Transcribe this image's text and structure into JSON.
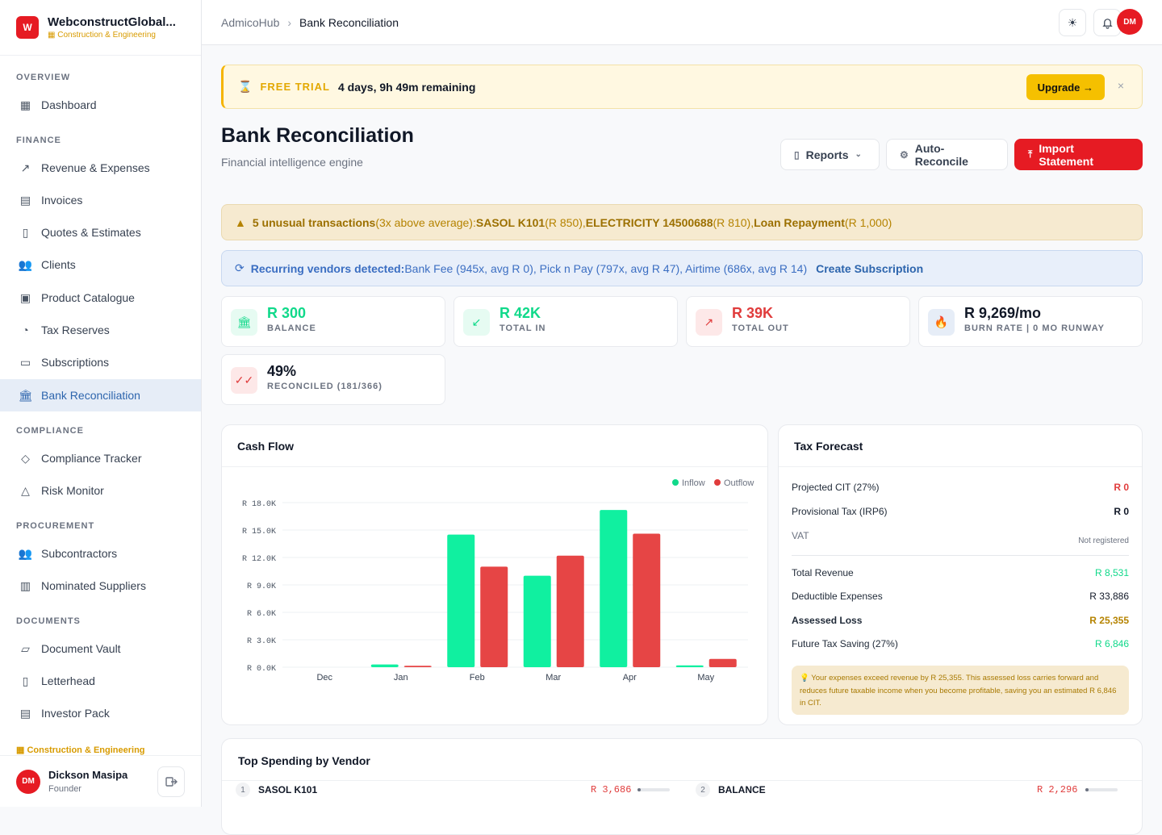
{
  "brand": {
    "logo": "W",
    "name": "WebconstructGlobal...",
    "industry": "Construction & Engineering"
  },
  "sidebar": {
    "sections": [
      {
        "title": "OVERVIEW",
        "items": [
          {
            "label": "Dashboard",
            "icon": "dashboard-icon"
          }
        ]
      },
      {
        "title": "FINANCE",
        "items": [
          {
            "label": "Revenue & Expenses",
            "icon": "chart-line-icon"
          },
          {
            "label": "Invoices",
            "icon": "invoice-icon"
          },
          {
            "label": "Quotes & Estimates",
            "icon": "quote-icon"
          },
          {
            "label": "Clients",
            "icon": "users-icon"
          },
          {
            "label": "Product Catalogue",
            "icon": "package-icon"
          },
          {
            "label": "Tax Reserves",
            "icon": "piggy-bank-icon"
          },
          {
            "label": "Subscriptions",
            "icon": "card-icon"
          },
          {
            "label": "Bank Reconciliation",
            "icon": "bank-icon",
            "active": true
          }
        ]
      },
      {
        "title": "COMPLIANCE",
        "items": [
          {
            "label": "Compliance Tracker",
            "icon": "shield-icon"
          },
          {
            "label": "Risk Monitor",
            "icon": "warning-icon"
          }
        ]
      },
      {
        "title": "PROCUREMENT",
        "items": [
          {
            "label": "Subcontractors",
            "icon": "people-icon"
          },
          {
            "label": "Nominated Suppliers",
            "icon": "store-icon"
          }
        ]
      },
      {
        "title": "DOCUMENTS",
        "items": [
          {
            "label": "Document Vault",
            "icon": "folder-icon"
          },
          {
            "label": "Letterhead",
            "icon": "file-icon"
          },
          {
            "label": "Investor Pack",
            "icon": "briefcase-icon"
          }
        ]
      }
    ],
    "industry_label": "Construction & Engineering",
    "user": {
      "initials": "DM",
      "name": "Dickson Masipa",
      "role": "Founder"
    }
  },
  "topbar": {
    "crumb_root": "AdmicoHub",
    "crumb_current": "Bank Reconciliation",
    "avatar": "DM"
  },
  "trial": {
    "label": "FREE TRIAL",
    "time": "4 days, 9h 49m remaining",
    "upgrade": "Upgrade →",
    "close": "×"
  },
  "header": {
    "title": "Bank Reconciliation",
    "subtitle": "Financial intelligence engine",
    "reports": "Reports",
    "auto": "Auto-Reconcile",
    "import": "Import Statement"
  },
  "alerts": {
    "unusual_count": "5 unusual transactions",
    "unusual_mid": " (3x above average): ",
    "u1": "SASOL K101",
    "u1v": " (R 850), ",
    "u2": "ELECTRICITY 14500688",
    "u2v": " (R 810), ",
    "u3": "Loan Repayment",
    "u3v": " (R 1,000)",
    "recurring_label": "Recurring vendors detected:",
    "recurring_text": " Bank Fee (945x, avg R 0), Pick n Pay (797x, avg R 47), Airtime (686x, avg R 14)",
    "recurring_link": "Create Subscription"
  },
  "stats": [
    {
      "value": "R 300",
      "label": "BALANCE",
      "color": "#10d98a",
      "bg": "#e6fbf2",
      "glyph": "🏛",
      "glyph_name": "bank-icon"
    },
    {
      "value": "R 42K",
      "label": "TOTAL IN",
      "color": "#10d98a",
      "bg": "#e6fbf2",
      "glyph": "↙",
      "glyph_name": "arrow-down-left-icon"
    },
    {
      "value": "R 39K",
      "label": "TOTAL OUT",
      "color": "#e03c3c",
      "bg": "#fde8e8",
      "glyph": "↗",
      "glyph_name": "arrow-up-right-icon"
    },
    {
      "value": "R 9,269/mo",
      "label": "BURN RATE | 0 MO RUNWAY",
      "color": "#111827",
      "bg": "#e6edf7",
      "glyph": "🔥",
      "glyph_name": "flame-icon"
    },
    {
      "value": "49%",
      "label": "RECONCILED (181/366)",
      "color": "#111827",
      "bg": "#fde8e8",
      "glyph": "✓✓",
      "glyph_name": "check-double-icon"
    }
  ],
  "cashflow": {
    "title": "Cash Flow",
    "legend_in": "Inflow",
    "legend_out": "Outflow"
  },
  "chart_data": {
    "type": "bar",
    "title": "Cash Flow",
    "categories": [
      "Dec",
      "Jan",
      "Feb",
      "Mar",
      "Apr",
      "May"
    ],
    "series": [
      {
        "name": "Inflow",
        "color": "#10f0a0",
        "values": [
          0,
          300,
          14500,
          10000,
          17200,
          200
        ]
      },
      {
        "name": "Outflow",
        "color": "#e64545",
        "values": [
          0,
          150,
          11000,
          12200,
          14600,
          900
        ]
      }
    ],
    "ylim": [
      0,
      18000
    ],
    "yticks": [
      0,
      3000,
      6000,
      9000,
      12000,
      15000,
      18000
    ],
    "ytick_labels": [
      "R 0.0K",
      "R 3.0K",
      "R 6.0K",
      "R 9.0K",
      "R 12.0K",
      "R 15.0K",
      "R 18.0K"
    ],
    "legend": "top-right",
    "grid": true
  },
  "tax": {
    "title": "Tax Forecast",
    "rows": [
      {
        "label": "Projected CIT (27%)",
        "value": "R 0",
        "color": "#e03c3c"
      },
      {
        "label": "Provisional Tax (IRP6)",
        "value": "R 0",
        "color": "#111827"
      },
      {
        "label": "VAT",
        "value": "Not registered",
        "color": "#6b7280"
      },
      {
        "label": "Total Revenue",
        "value": "R 8,531",
        "color": "#10d98a"
      },
      {
        "label": "Deductible Expenses",
        "value": "R 33,886",
        "color": "#111827"
      },
      {
        "label": "Assessed Loss",
        "value": "R 25,355",
        "color": "#b58300"
      },
      {
        "label": "Future Tax Saving (27%)",
        "value": "R 6,846",
        "color": "#10d98a"
      }
    ],
    "note": "💡 Your expenses exceed revenue by R 25,355. This assessed loss carries forward and reduces future taxable income when you become profitable, saving you an estimated R 6,846 in CIT."
  },
  "vendors": {
    "title": "Top Spending by Vendor",
    "items": [
      {
        "rank": "1",
        "name": "SASOL K101",
        "amount": "R 3,686"
      },
      {
        "rank": "2",
        "name": "BALANCE",
        "amount": "R 2,296"
      }
    ]
  }
}
